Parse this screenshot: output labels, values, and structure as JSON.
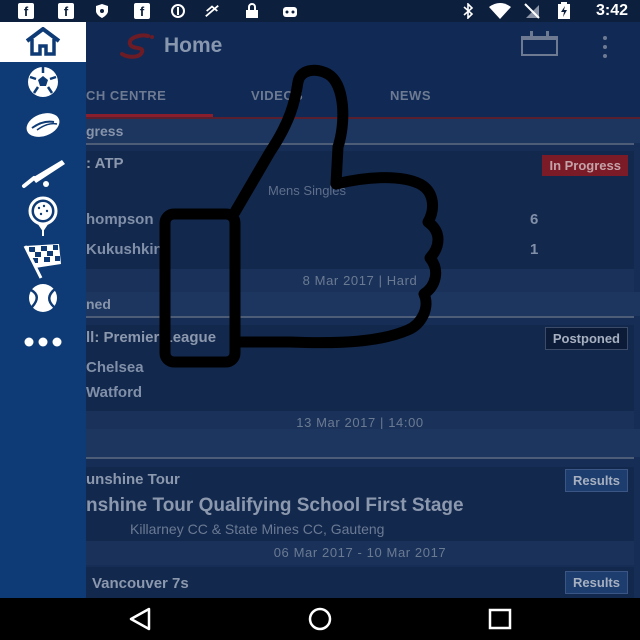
{
  "status_bar": {
    "time": "3:42",
    "icons": [
      "facebook-icon",
      "facebook-icon",
      "shield-icon",
      "facebook-icon",
      "vpn-icon",
      "no-connection-icon",
      "lock-icon",
      "android-icon",
      "bluetooth-icon",
      "wifi-icon",
      "no-sim-icon",
      "battery-charging-icon"
    ]
  },
  "toolbar": {
    "title": "Home",
    "logo": "supersport-logo",
    "actions": [
      "calendar-icon",
      "overflow-menu-icon"
    ]
  },
  "tabs": [
    "MATCH CENTRE",
    "VIDEOS",
    "NEWS"
  ],
  "tabs_visible": [
    "CH CENTRE",
    "VIDEOS",
    "NEWS"
  ],
  "sections": {
    "in_progress": {
      "label": "gress",
      "event": {
        "title": ": ATP",
        "badge": "In Progress",
        "category": "Mens Singles",
        "players": [
          {
            "name": "hompson",
            "score": "6"
          },
          {
            "name": "Kukushkin",
            "score": "1"
          }
        ],
        "footer": "8 Mar 2017 |  Hard"
      }
    },
    "postponed": {
      "label": "ned",
      "event": {
        "title": "ll: Premier League",
        "badge": "Postponed",
        "teams": [
          "Chelsea",
          "Watford"
        ],
        "footer": "13 Mar 2017  |  14:00"
      }
    },
    "results": {
      "event1": {
        "title": "unshine Tour",
        "badge": "Results",
        "headline": "nshine Tour Qualifying School First Stage",
        "venue": "Killarney CC & State Mines CC, Gauteng",
        "footer": "06 Mar 2017  -  10 Mar 2017"
      },
      "event2": {
        "title": "Vancouver 7s",
        "badge": "Results"
      }
    }
  },
  "drawer": {
    "items": [
      "home-icon",
      "soccer-icon",
      "rugby-icon",
      "cricket-icon",
      "golf-icon",
      "motorsport-icon",
      "tennis-icon",
      "more-icon"
    ]
  },
  "nav_bar": [
    "back-icon",
    "home-nav-icon",
    "recents-icon"
  ],
  "colors": {
    "toolbar": "#102a55",
    "drawer": "#0e3b75",
    "in_progress": "#7b1b27",
    "overlay_stroke": "#000000"
  }
}
